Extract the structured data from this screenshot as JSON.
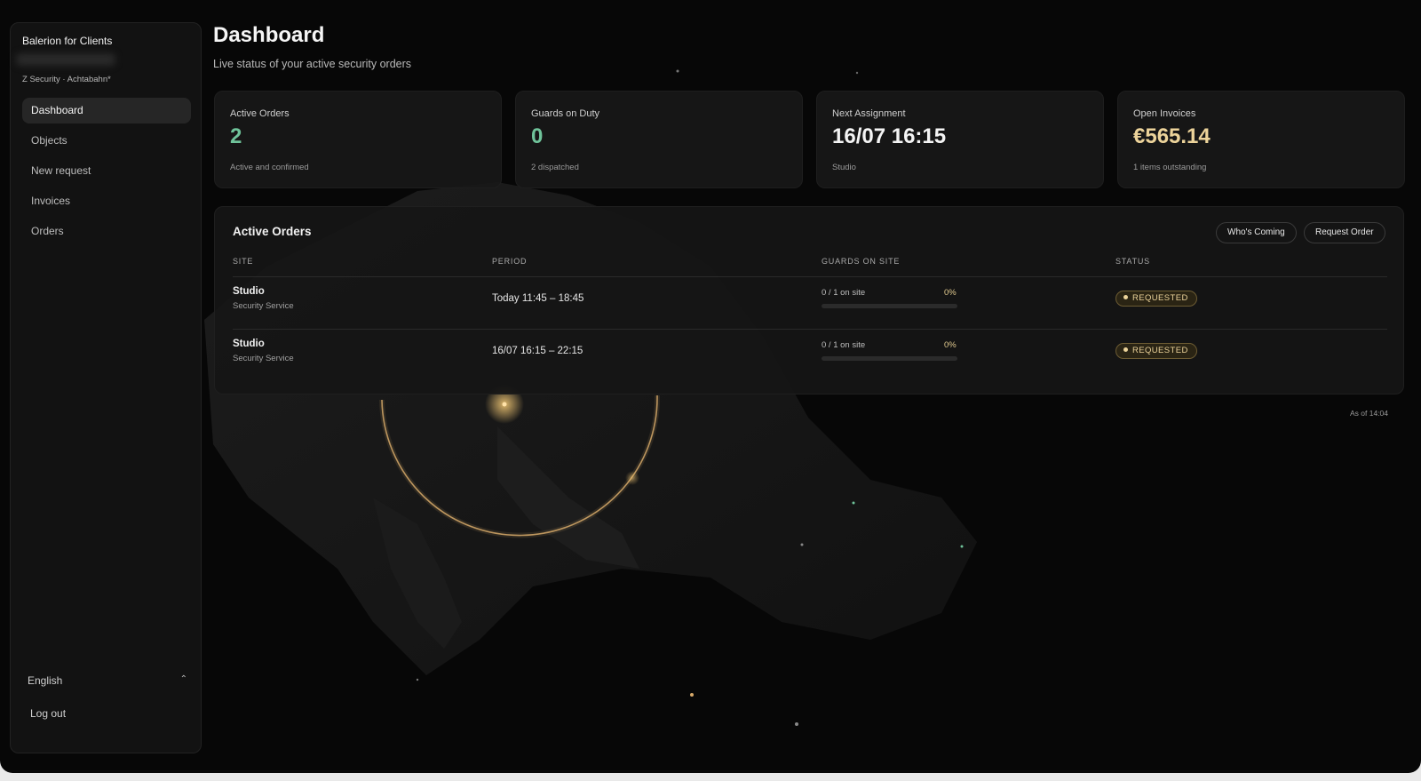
{
  "sidebar": {
    "brand": "Balerion for Clients",
    "org": "Z Security · Achtabahn*",
    "items": [
      {
        "label": "Dashboard",
        "active": true
      },
      {
        "label": "Objects",
        "active": false
      },
      {
        "label": "New request",
        "active": false
      },
      {
        "label": "Invoices",
        "active": false
      },
      {
        "label": "Orders",
        "active": false
      }
    ],
    "language": "English",
    "language_icon": "chevron-updown-icon",
    "logout": "Log out"
  },
  "header": {
    "title": "Dashboard",
    "subtitle": "Live status of your active security orders"
  },
  "stats": [
    {
      "label": "Active Orders",
      "value": "2",
      "sub": "Active and confirmed",
      "color": "#6fc39a"
    },
    {
      "label": "Guards on Duty",
      "value": "0",
      "sub": "2 dispatched",
      "color": "#6fc39a"
    },
    {
      "label": "Next Assignment",
      "value": "16/07 16:15",
      "sub": "Studio",
      "color": "#f4f4f4"
    },
    {
      "label": "Open Invoices",
      "value": "€565.14",
      "sub": "1 items outstanding",
      "color": "#ecd39a"
    }
  ],
  "orders": {
    "title": "Active Orders",
    "whos_coming_label": "Who's Coming",
    "request_order_label": "Request Order",
    "columns": [
      "SITE",
      "PERIOD",
      "GUARDS ON SITE",
      "STATUS"
    ],
    "rows": [
      {
        "site": "Studio",
        "service": "Security Service",
        "period": "Today 11:45 – 18:45",
        "onsite": "0 / 1 on site",
        "pct": "0%",
        "progress": 0,
        "status": "REQUESTED"
      },
      {
        "site": "Studio",
        "service": "Security Service",
        "period": "16/07 16:15 – 22:15",
        "onsite": "0 / 1 on site",
        "pct": "0%",
        "progress": 0,
        "status": "REQUESTED"
      }
    ]
  },
  "as_of": "As of 14:04",
  "colors": {
    "accent_gold": "#ecd39a",
    "accent_green": "#6fc39a",
    "background": "#070707"
  }
}
